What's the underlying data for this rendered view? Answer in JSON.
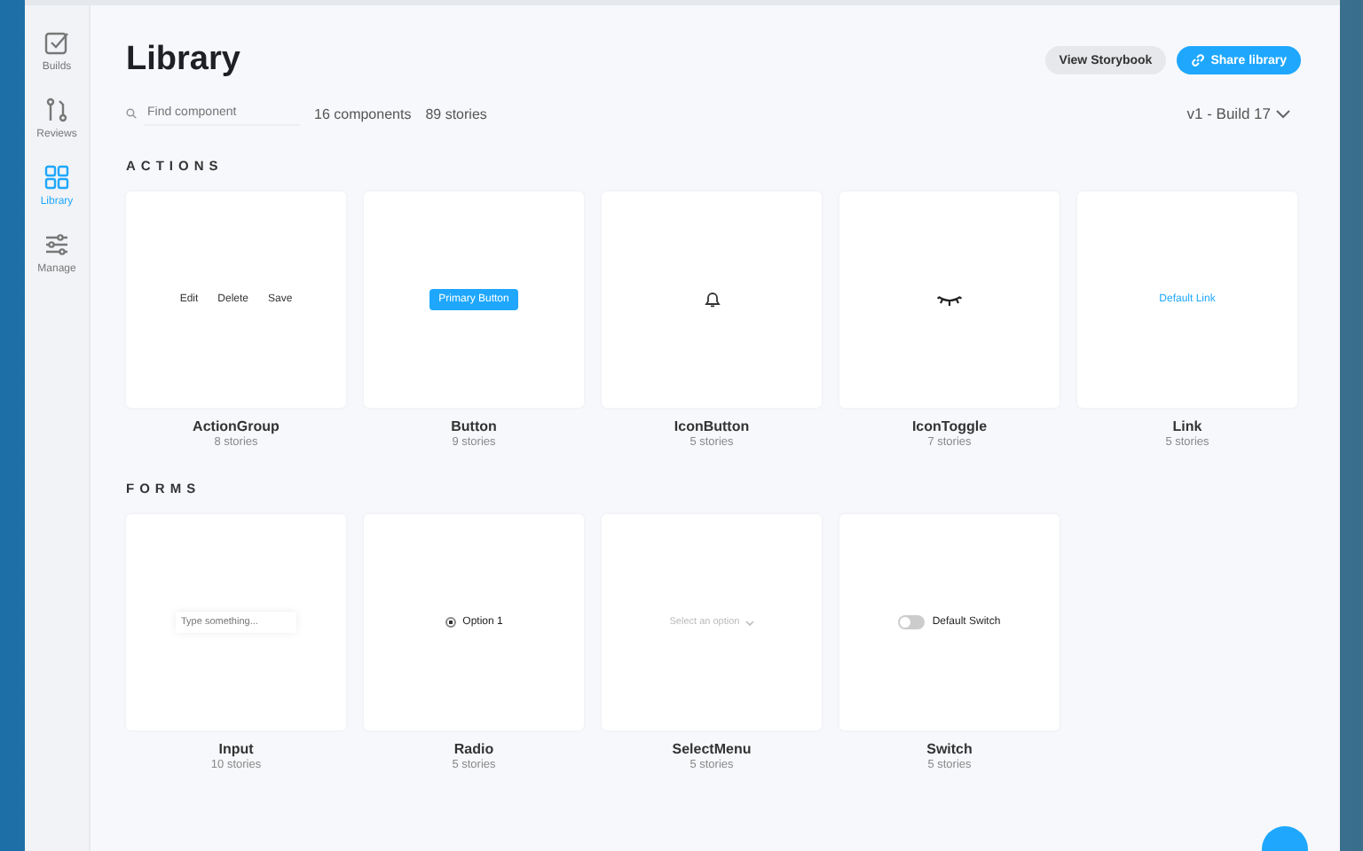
{
  "sidebar": {
    "items": [
      {
        "label": "Builds",
        "kind": "builds",
        "selected": false
      },
      {
        "label": "Reviews",
        "kind": "reviews",
        "selected": false
      },
      {
        "label": "Library",
        "kind": "library",
        "selected": true
      },
      {
        "label": "Manage",
        "kind": "manage",
        "selected": false
      }
    ]
  },
  "header": {
    "title": "Library",
    "buttons": [
      {
        "label": "View Storybook",
        "kind": "secondary"
      },
      {
        "label": "Share library",
        "kind": "primary"
      }
    ]
  },
  "search": {
    "placeholder": "Find component"
  },
  "counts": [
    "16 components",
    "89 stories"
  ],
  "version": "v1 - Build 17",
  "sections": [
    {
      "heading": "ACTIONS",
      "components": [
        {
          "name": "ActionGroup",
          "stories": "8 stories",
          "preview": {
            "kind": "actions",
            "items": [
              "Edit",
              "Delete",
              "Save"
            ]
          }
        },
        {
          "name": "Button",
          "stories": "9 stories",
          "preview": {
            "kind": "button",
            "text": "Primary Button"
          }
        },
        {
          "name": "IconButton",
          "stories": "5 stories",
          "preview": {
            "kind": "bell"
          }
        },
        {
          "name": "IconToggle",
          "stories": "7 stories",
          "preview": {
            "kind": "eye"
          }
        },
        {
          "name": "Link",
          "stories": "5 stories",
          "preview": {
            "kind": "link",
            "text": "Default Link"
          }
        }
      ]
    },
    {
      "heading": "FORMS",
      "components": [
        {
          "name": "Input",
          "stories": "10 stories",
          "preview": {
            "kind": "input",
            "placeholder": "Type something..."
          }
        },
        {
          "name": "Radio",
          "stories": "5 stories",
          "preview": {
            "kind": "radio",
            "text": "Option 1",
            "checked": true
          }
        },
        {
          "name": "SelectMenu",
          "stories": "5 stories",
          "preview": {
            "kind": "select",
            "text": "Select an option"
          }
        },
        {
          "name": "Switch",
          "stories": "5 stories",
          "preview": {
            "kind": "switch",
            "text": "Default Switch",
            "on": false
          }
        }
      ]
    }
  ]
}
